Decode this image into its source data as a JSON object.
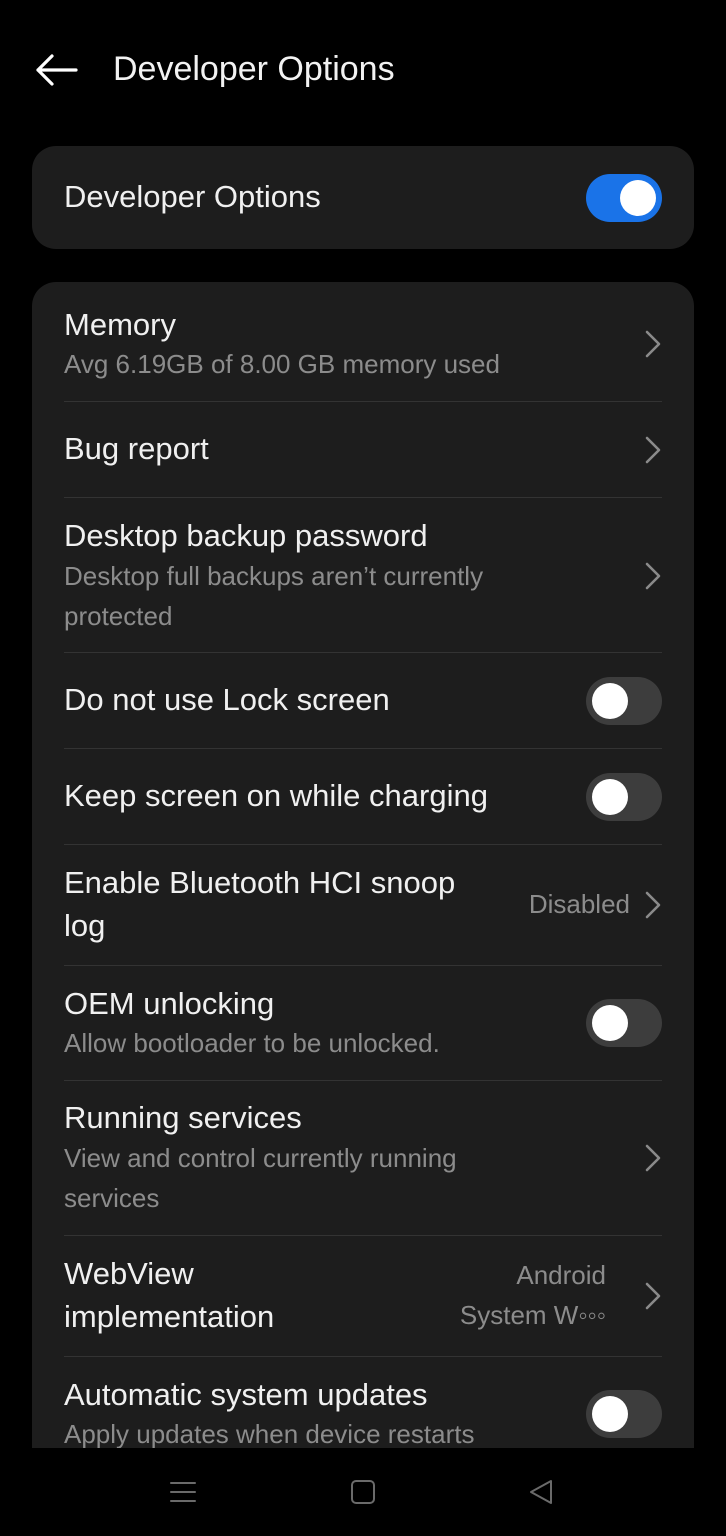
{
  "header": {
    "title": "Developer Options",
    "back_icon": "arrow-left-icon"
  },
  "master": {
    "label": "Developer Options",
    "enabled": true
  },
  "items": [
    {
      "title": "Memory",
      "subtitle": "Avg 6.19GB of 8.00 GB memory used",
      "control": "chevron"
    },
    {
      "title": "Bug report",
      "control": "chevron"
    },
    {
      "title": "Desktop backup password",
      "subtitle_line1": "Desktop full backups aren’t currently",
      "subtitle_line2": "protected",
      "control": "chevron"
    },
    {
      "title": "Do not use Lock screen",
      "control": "toggle",
      "enabled": false
    },
    {
      "title": "Keep screen on while charging",
      "control": "toggle",
      "enabled": false
    },
    {
      "title_line1": "Enable Bluetooth HCI snoop",
      "title_line2": "log",
      "value": "Disabled",
      "control": "chevron"
    },
    {
      "title": "OEM unlocking",
      "subtitle": "Allow bootloader to be unlocked.",
      "control": "toggle",
      "enabled": false
    },
    {
      "title": "Running services",
      "subtitle_line1": "View and control currently running",
      "subtitle_line2": "services",
      "control": "chevron"
    },
    {
      "title_line1": "WebView",
      "title_line2": "implementation",
      "value_line1": "Android",
      "value_line2": "System W◦◦◦",
      "control": "chevron"
    },
    {
      "title": "Automatic system updates",
      "subtitle": "Apply updates when device restarts",
      "control": "toggle",
      "enabled": false
    }
  ],
  "navbar": {
    "menu_icon": "menu-icon",
    "home_icon": "home-square-icon",
    "back_icon": "back-triangle-icon"
  },
  "colors": {
    "accent": "#1a73e8",
    "card": "#1d1d1d",
    "background": "#000000",
    "secondary_text": "#8c8c8c"
  }
}
